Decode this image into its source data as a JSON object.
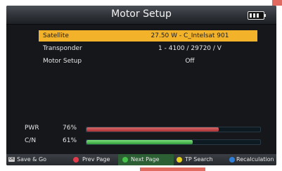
{
  "header": {
    "title": "Motor Setup",
    "icon": "battery-icon"
  },
  "rows": [
    {
      "label": "Satellite",
      "value": "27.50 W - C_Intelsat 901",
      "selected": true
    },
    {
      "label": "Transponder",
      "value": "1 - 4100 / 29720 / V",
      "selected": false
    },
    {
      "label": "Motor Setup",
      "value": "Off",
      "selected": false
    }
  ],
  "meters": [
    {
      "label": "PWR",
      "percent_text": "76%",
      "level": 0.76,
      "color": "#c24a4d"
    },
    {
      "label": "C/N",
      "percent_text": "61%",
      "level": 0.61,
      "color": "#49c04c"
    }
  ],
  "footer": [
    {
      "key": "ok-key-icon",
      "label": "Save & Go"
    },
    {
      "key": "red-key-icon",
      "label": "Prev Page",
      "color": "#e23b4b"
    },
    {
      "key": "green-key-icon",
      "label": "Next Page",
      "color": "#46c24a"
    },
    {
      "key": "yellow-key-icon",
      "label": "TP Search",
      "color": "#e8d21f"
    },
    {
      "key": "blue-key-icon",
      "label": "Recalculation",
      "color": "#2f7fd8"
    }
  ]
}
